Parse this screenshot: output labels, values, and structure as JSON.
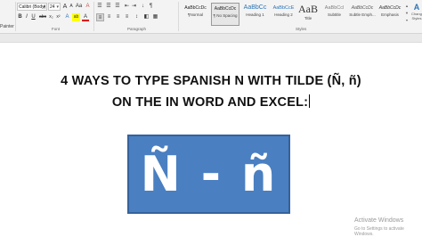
{
  "ribbon": {
    "clipboard": {
      "painter_label": "Painter"
    },
    "font": {
      "font_name": "Calibri (Body)",
      "font_size": "24",
      "buttons": {
        "grow": "A",
        "shrink": "A",
        "case": "Aa",
        "clear": "A",
        "bold": "B",
        "italic": "I",
        "underline": "U",
        "strike": "abc",
        "sub": "x₂",
        "sup": "x²",
        "effects": "A",
        "highlight": "ab",
        "color": "A"
      },
      "group_label": "Font"
    },
    "paragraph": {
      "buttons": {
        "bullets": "☰",
        "numbering": "☰",
        "multilevel": "☰",
        "decrease_indent": "⇤",
        "increase_indent": "⇥",
        "sort": "↓",
        "show_marks": "¶",
        "align_left": "≡",
        "center": "≡",
        "align_right": "≡",
        "justify": "≡",
        "line_spacing": "↕",
        "shading": "◧",
        "borders": "▦"
      },
      "group_label": "Paragraph"
    },
    "styles": {
      "items": [
        {
          "sample": "¶Normal",
          "name": "",
          "active": false
        },
        {
          "sample": "AaBbCcDc",
          "name": "¶ No Spacing",
          "active": true
        },
        {
          "sample": "AaBbCc",
          "name": "Heading 1",
          "active": false
        },
        {
          "sample": "AaBbCcE",
          "name": "Heading 2",
          "active": false
        },
        {
          "sample": "AaB",
          "name": "Title",
          "active": false
        },
        {
          "sample": "AaBbCcl",
          "name": "Subtitle",
          "active": false
        },
        {
          "sample": "AaBbCcDc",
          "name": "Subtle Emph...",
          "active": false
        },
        {
          "sample": "AaBbCcDc",
          "name": "Emphasis",
          "active": false
        }
      ],
      "first_sample": "AaBbCcDc",
      "group_label": "Styles"
    },
    "right_tool": "Change Styles"
  },
  "document": {
    "line1": "4 WAYS TO TYPE SPANISH N WITH TILDE (Ñ, ñ)",
    "line2": "ON THE IN WORD AND EXCEL:",
    "banner_text": "Ñ - ñ"
  },
  "watermark": {
    "line1": "Activate Windows",
    "line2": "Go to Settings to activate Windows."
  }
}
